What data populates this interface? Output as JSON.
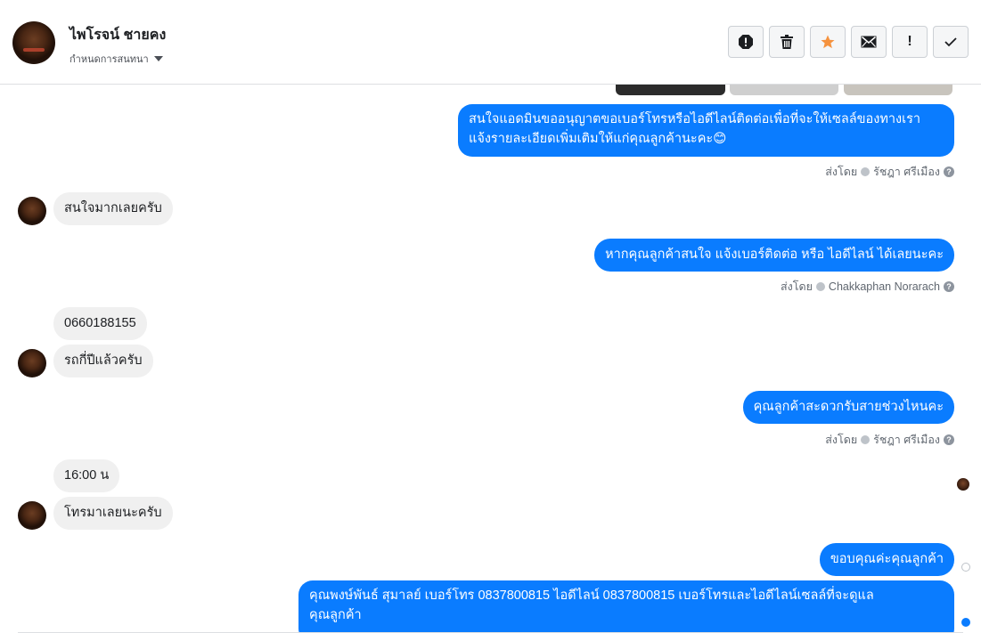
{
  "header": {
    "contact_name": "ไพโรจน์ ชายคง",
    "subtitle": "กำหนดการสนทนา",
    "buttons": {
      "spam": "spam-icon",
      "delete": "trash-icon",
      "star": "star-icon",
      "email": "envelope-icon",
      "important": "!",
      "done": "check-icon"
    }
  },
  "colors": {
    "outgoing": "#0a7cff",
    "incoming": "#f0f0f0",
    "star": "#f5923e"
  },
  "messages": {
    "m1_line1": "สนใจแอดมินขออนุญาตขอเบอร์โทรหรือไอดีไลน์ติดต่อเพื่อที่จะให้เซลล์ของทางเรา",
    "m1_line2": "แจ้งรายละเอียดเพิ่มเติมให้แก่คุณลูกค้านะคะ😊",
    "m1_sender_prefix": "ส่งโดย",
    "m1_sender": "รัชฎา ศรีเมือง",
    "m2": "สนใจมากเลยครับ",
    "m3": "หากคุณลูกค้าสนใจ แจ้งเบอร์ติดต่อ หรือ ไอดีไลน์ ได้เลยนะคะ",
    "m3_sender_prefix": "ส่งโดย",
    "m3_sender": "Chakkaphan Norarach",
    "m4": "0660188155",
    "m5": "รถกี่ปีแล้วครับ",
    "m6": "คุณลูกค้าสะดวกรับสายช่วงไหนคะ",
    "m6_sender_prefix": "ส่งโดย",
    "m6_sender": "รัชฎา ศรีเมือง",
    "m7": "16:00 น",
    "m8": "โทรมาเลยนะครับ",
    "m9": "ขอบคุณค่ะคุณลูกค้า",
    "m10_line1": "คุณพงษ์พันธ์ สุมาลย์      เบอร์โทร 0837800815  ไอดีไลน์ 0837800815   เบอร์โทรและไอดีไลน์เซลล์ที่จะดูแล",
    "m10_line2": "คุณลูกค้า",
    "help_mark": "?"
  }
}
